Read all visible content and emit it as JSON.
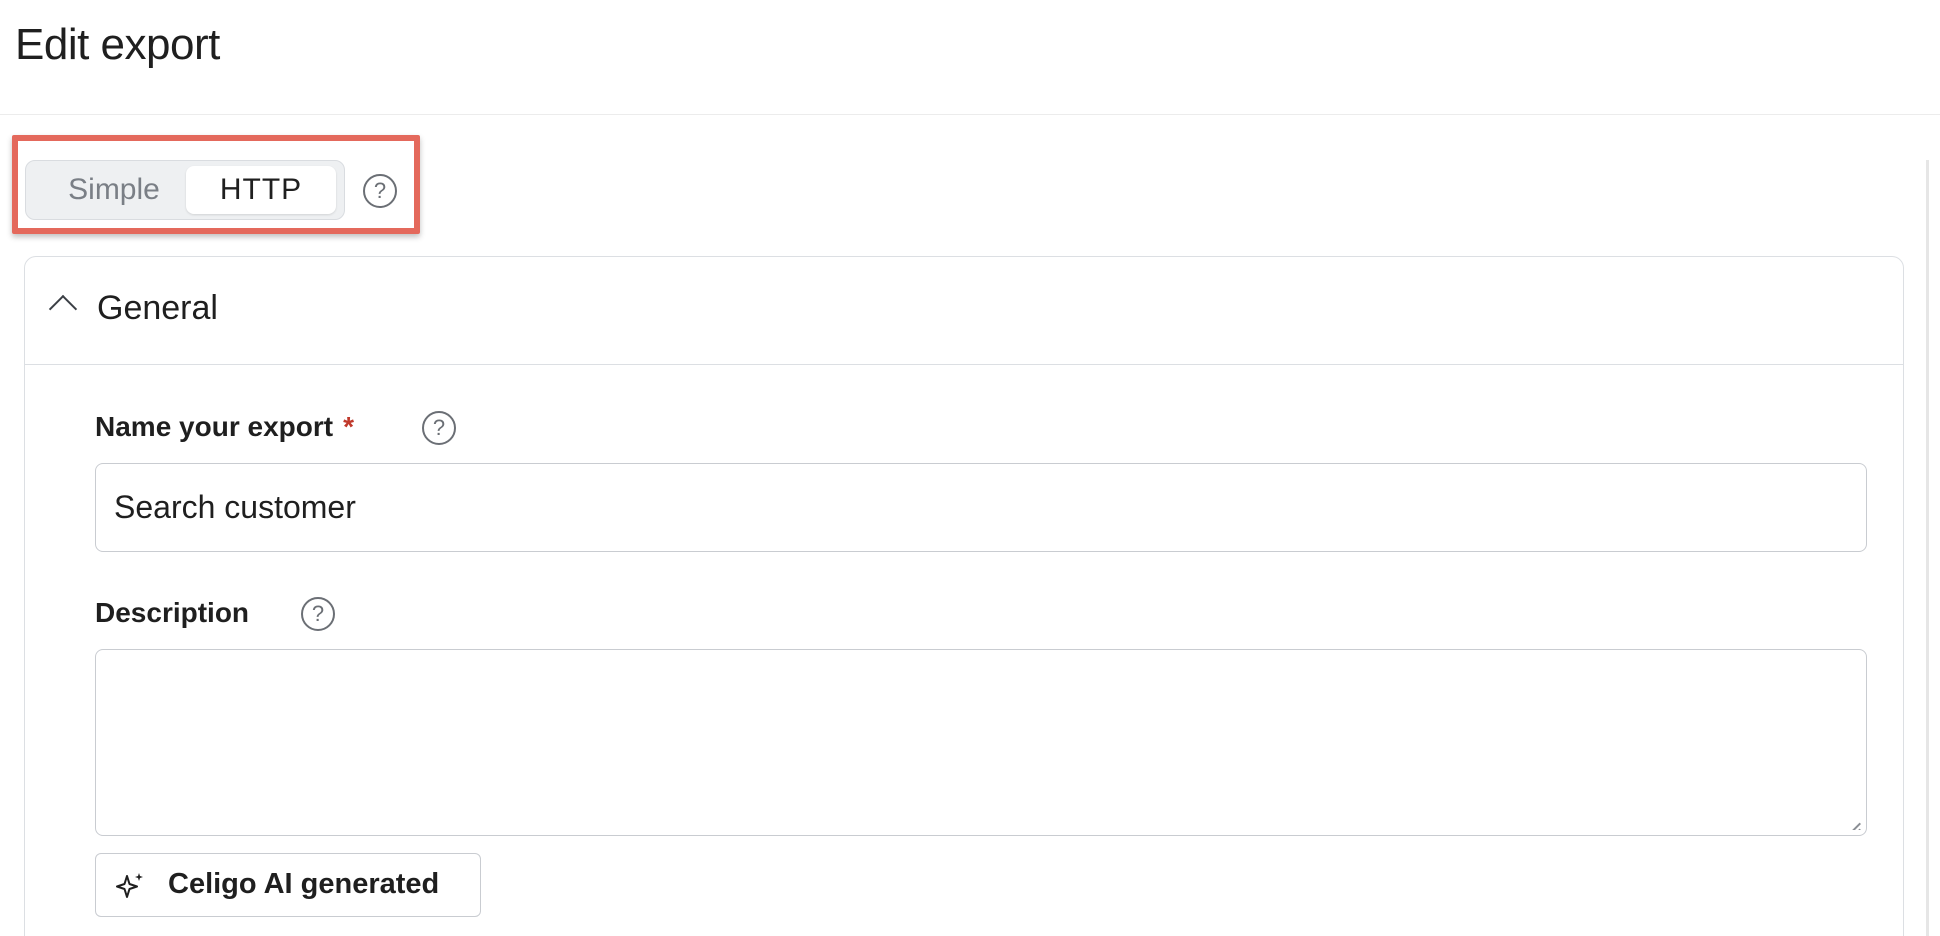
{
  "header": {
    "title": "Edit export"
  },
  "mode_toggle": {
    "options": [
      "Simple",
      "HTTP"
    ],
    "selected": "HTTP",
    "help_glyph": "?"
  },
  "section": {
    "title": "General",
    "expanded": true,
    "chevron_icon": "chevron-up-icon"
  },
  "fields": {
    "name": {
      "label": "Name your export",
      "required_marker": "*",
      "value": "Search customer",
      "help_glyph": "?"
    },
    "description": {
      "label": "Description",
      "value": "",
      "help_glyph": "?"
    }
  },
  "ai_button": {
    "label": "Celigo AI generated",
    "icon": "sparkle-icon"
  },
  "colors": {
    "highlight_border": "#e4695c",
    "required_star": "#c0392b",
    "toggle_bg": "#eef0f2",
    "border": "#c9ccd1"
  }
}
